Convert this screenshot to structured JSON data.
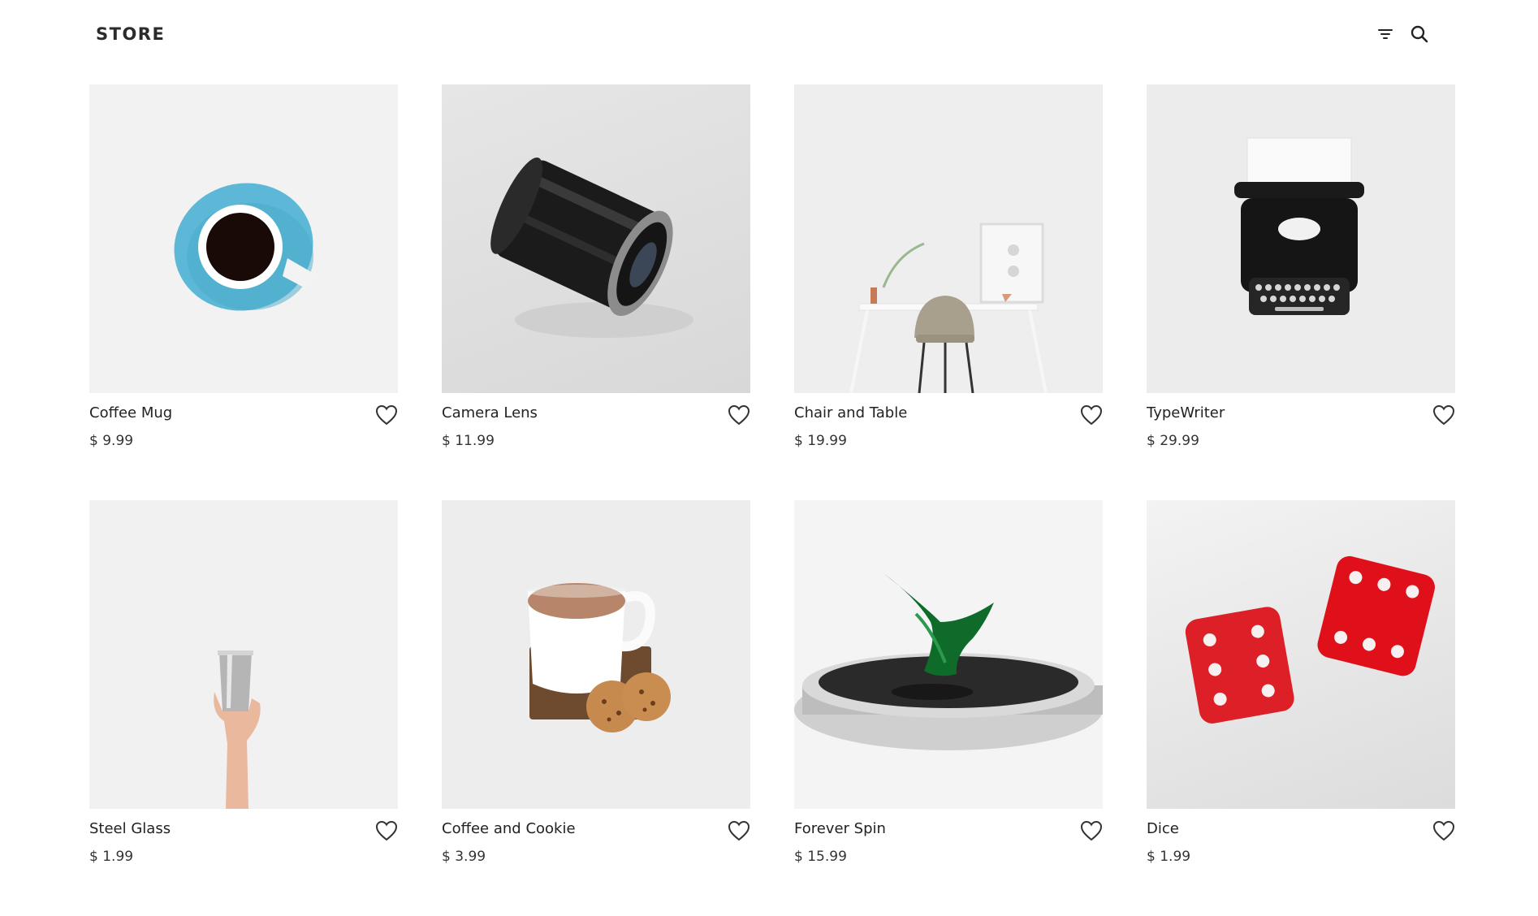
{
  "header": {
    "logo": "STORE",
    "filter_icon": "filter-icon",
    "search_icon": "search-icon"
  },
  "products": [
    {
      "name": "Coffee Mug",
      "price": "$ 9.99",
      "image": "coffee-mug"
    },
    {
      "name": "Camera Lens",
      "price": "$ 11.99",
      "image": "camera-lens"
    },
    {
      "name": "Chair and Table",
      "price": "$ 19.99",
      "image": "chair-and-table"
    },
    {
      "name": "TypeWriter",
      "price": "$ 29.99",
      "image": "typewriter"
    },
    {
      "name": "Steel Glass",
      "price": "$ 1.99",
      "image": "steel-glass"
    },
    {
      "name": "Coffee and Cookie",
      "price": "$ 3.99",
      "image": "coffee-and-cookie"
    },
    {
      "name": "Forever Spin",
      "price": "$ 15.99",
      "image": "forever-spin"
    },
    {
      "name": "Dice",
      "price": "$ 1.99",
      "image": "dice"
    }
  ],
  "icons": {
    "favorite": "heart-icon"
  },
  "colors": {
    "text": "#222222",
    "background": "#ffffff",
    "tile": "#eeeeee"
  }
}
